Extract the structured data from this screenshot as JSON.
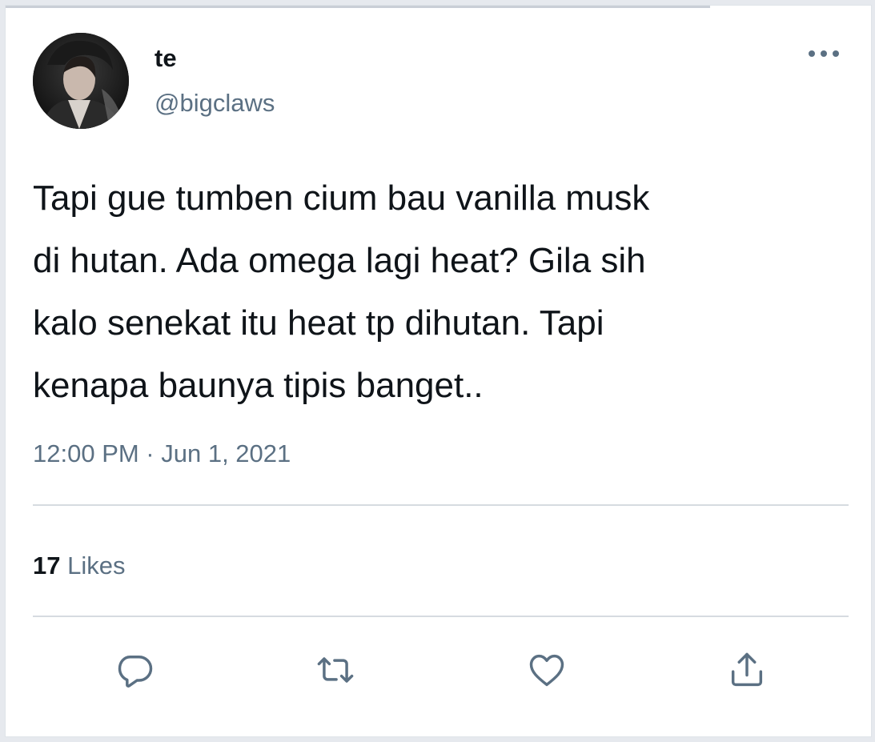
{
  "author": {
    "display_name": "te",
    "handle": "@bigclaws"
  },
  "tweet": {
    "text": "Tapi gue tumben cium bau vanilla musk\ndi hutan. Ada omega lagi heat? Gila sih\nkalo senekat itu heat tp dihutan. Tapi\nkenapa baunya tipis banget..",
    "timestamp": "12:00 PM · Jun 1, 2021"
  },
  "stats": {
    "likes_count": "17",
    "likes_label": "Likes"
  },
  "actions": {
    "icons": [
      "reply-icon",
      "retweet-icon",
      "like-icon",
      "share-icon"
    ]
  },
  "colors": {
    "text": "#0f1419",
    "secondary": "#5b7083",
    "divider": "#d6dbe0",
    "icon": "#5b7083"
  }
}
